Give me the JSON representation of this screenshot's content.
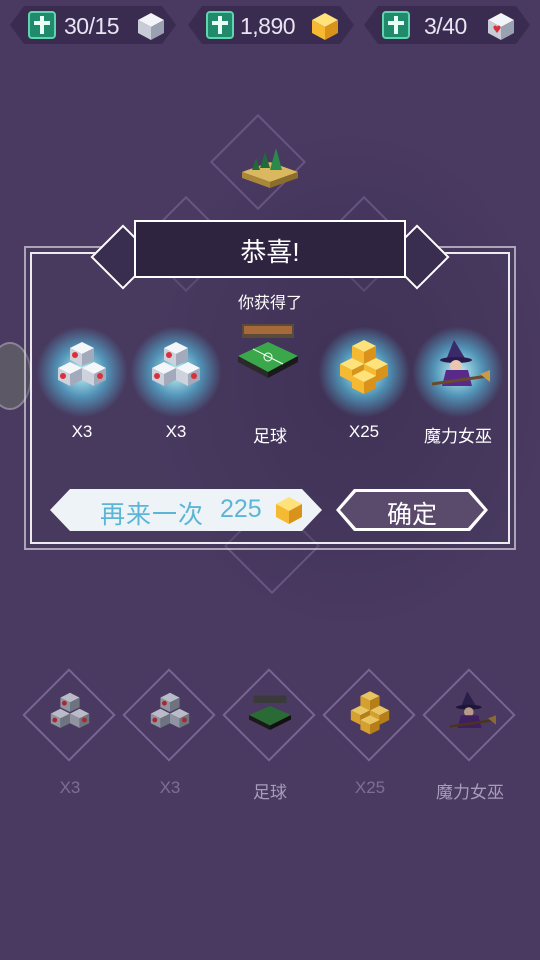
{
  "resources": [
    {
      "value": "30/15",
      "icon": "silver-cube-icon"
    },
    {
      "value": "1,890",
      "icon": "gold-cube-icon"
    },
    {
      "value": "3/40",
      "icon": "red-cube-icon"
    }
  ],
  "dialog": {
    "title": "恭喜!",
    "subtitle": "你获得了",
    "rewards": [
      {
        "label": "X3",
        "icon": "heart-cubes-icon"
      },
      {
        "label": "X3",
        "icon": "heart-cubes-icon"
      },
      {
        "label": "足球",
        "icon": "soccer-field-icon"
      },
      {
        "label": "X25",
        "icon": "gold-cubes-icon"
      },
      {
        "label": "魔力女巫",
        "icon": "witch-icon"
      }
    ],
    "again_label": "再来一次",
    "again_cost": "225",
    "ok_label": "确定"
  },
  "bottom_items": [
    {
      "label": "X3",
      "icon": "heart-cubes-icon"
    },
    {
      "label": "X3",
      "icon": "heart-cubes-icon"
    },
    {
      "label": "足球",
      "icon": "soccer-field-icon"
    },
    {
      "label": "X25",
      "icon": "gold-cubes-icon"
    },
    {
      "label": "魔力女巫",
      "icon": "witch-icon"
    }
  ],
  "colors": {
    "background": "#4a3a62",
    "plus_green": "#1f8a6c",
    "gold": "#f5c242",
    "again_text": "#5bb6d6",
    "ok_bg": "#5a4a6c"
  }
}
